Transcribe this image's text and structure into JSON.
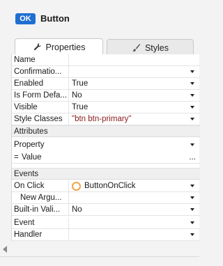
{
  "header": {
    "badge": "OK",
    "title": "Button"
  },
  "tabs": [
    {
      "label": "Properties",
      "icon": "wrench-icon",
      "active": true
    },
    {
      "label": "Styles",
      "icon": "brush-icon",
      "active": false
    }
  ],
  "properties": [
    {
      "label": "Name",
      "value": "",
      "dropdown": false
    },
    {
      "label": "Confirmatio...",
      "value": "",
      "dropdown": true
    },
    {
      "label": "Enabled",
      "value": "True",
      "dropdown": true
    },
    {
      "label": "Is Form Defa...",
      "value": "No",
      "dropdown": true
    },
    {
      "label": "Visible",
      "value": "True",
      "dropdown": true
    },
    {
      "label": "Style Classes",
      "value": "\"btn btn-primary\"",
      "dropdown": true
    }
  ],
  "attributes": {
    "title": "Attributes",
    "property_placeholder": "Property",
    "value_prefix": "=",
    "value_placeholder": "Value",
    "ellipsis": "..."
  },
  "events": {
    "title": "Events",
    "on_click_label": "On Click",
    "on_click_value": "ButtonOnClick",
    "new_args_label": "New Argu...",
    "builtin_label": "Built-in Vali...",
    "builtin_value": "No",
    "event_label": "Event",
    "handler_label": "Handler"
  },
  "colors": {
    "accent": "#1f6fd1",
    "string_value": "#8a1d1d",
    "event_circle": "#f0a347"
  }
}
